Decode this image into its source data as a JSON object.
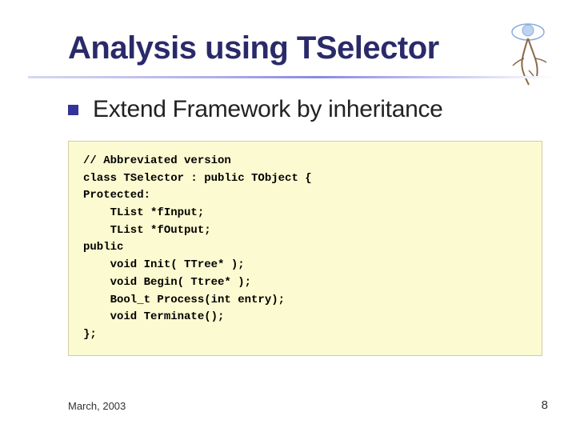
{
  "title": "Analysis using TSelector",
  "bullet": "Extend Framework by inheritance",
  "code": "// Abbreviated version\nclass TSelector : public TObject {\nProtected:\n    TList *fInput;\n    TList *fOutput;\npublic\n    void Init( TTree* );\n    void Begin( Ttree* );\n    Bool_t Process(int entry);\n    void Terminate();\n};",
  "footer_date": "March, 2003",
  "page_number": "8"
}
